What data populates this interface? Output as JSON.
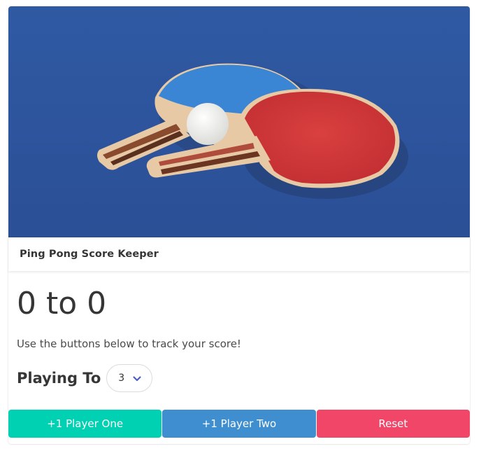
{
  "header": {
    "title": "Ping Pong Score Keeper"
  },
  "score": {
    "player_one": "0",
    "separator": " to ",
    "player_two": "0"
  },
  "hint": "Use the buttons below to track your score!",
  "playing_to": {
    "label": "Playing To",
    "selected": "3"
  },
  "buttons": {
    "player_one": "+1 Player One",
    "player_two": "+1 Player Two",
    "reset": "Reset"
  },
  "colors": {
    "table_blue": "#3054a0",
    "paddle_blue": "#3a86d4",
    "paddle_red": "#d33a3c",
    "btn_p1": "#00d1b2",
    "btn_p2": "#3e8ed0",
    "btn_reset": "#f14668"
  },
  "icons": {
    "select_arrow": "chevron-down-icon"
  }
}
